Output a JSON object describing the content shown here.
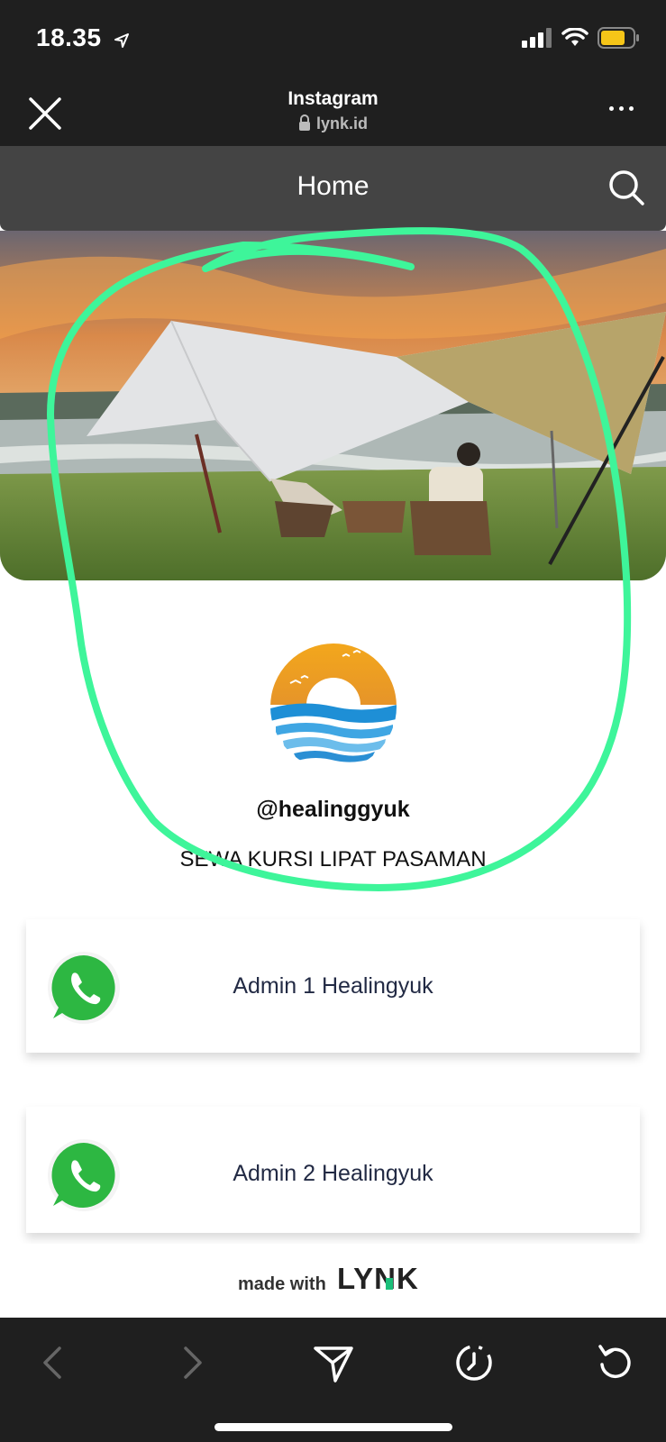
{
  "status_bar": {
    "time": "18.35"
  },
  "browser": {
    "title": "Instagram",
    "url": "lynk.id"
  },
  "page": {
    "header_title": "Home",
    "username": "@healinggyuk",
    "bio": "SEWA KURSI LIPAT PASAMAN",
    "links": [
      {
        "label": "Admin 1 Healingyuk",
        "icon": "whatsapp-icon"
      },
      {
        "label": "Admin 2 Healingyuk",
        "icon": "whatsapp-icon"
      }
    ],
    "footer": {
      "made_with": "made with",
      "brand": "LYNK"
    }
  },
  "colors": {
    "annotation": "#3ef59a",
    "whatsapp": "#2db742",
    "brand_accent": "#1bbf7a"
  }
}
